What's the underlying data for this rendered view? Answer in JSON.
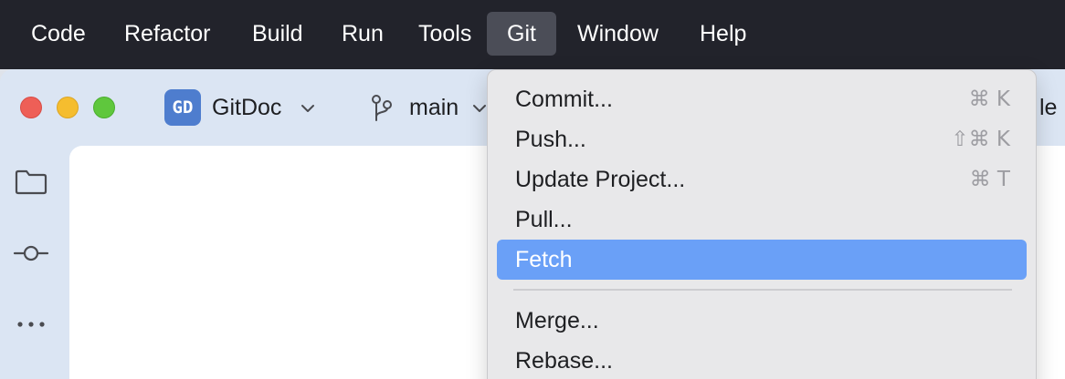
{
  "menubar": {
    "items": [
      {
        "label": "Code"
      },
      {
        "label": "Refactor"
      },
      {
        "label": "Build"
      },
      {
        "label": "Run"
      },
      {
        "label": "Tools"
      },
      {
        "label": "Git"
      },
      {
        "label": "Window"
      },
      {
        "label": "Help"
      }
    ],
    "active": "Git"
  },
  "titlebar": {
    "project_badge": "GD",
    "project_name": "GitDoc",
    "branch": "main",
    "cut_text": "le"
  },
  "git_menu": {
    "items": [
      {
        "label": "Commit...",
        "shortcut": "⌘ K"
      },
      {
        "label": "Push...",
        "shortcut": "⇧⌘ K"
      },
      {
        "label": "Update Project...",
        "shortcut": "⌘ T"
      },
      {
        "label": "Pull...",
        "shortcut": ""
      },
      {
        "label": "Fetch",
        "shortcut": ""
      },
      {
        "label": "Merge...",
        "shortcut": ""
      },
      {
        "label": "Rebase...",
        "shortcut": ""
      }
    ],
    "highlighted": "Fetch"
  },
  "colors": {
    "menubar_bg": "#22232b",
    "highlight": "#6aa0f7",
    "badge": "#4e7dce"
  },
  "icons": {
    "project_chevron": "chevron-down-icon",
    "branch": "git-branch-icon",
    "tools": [
      "folder-icon",
      "commit-icon",
      "more-icon"
    ]
  }
}
